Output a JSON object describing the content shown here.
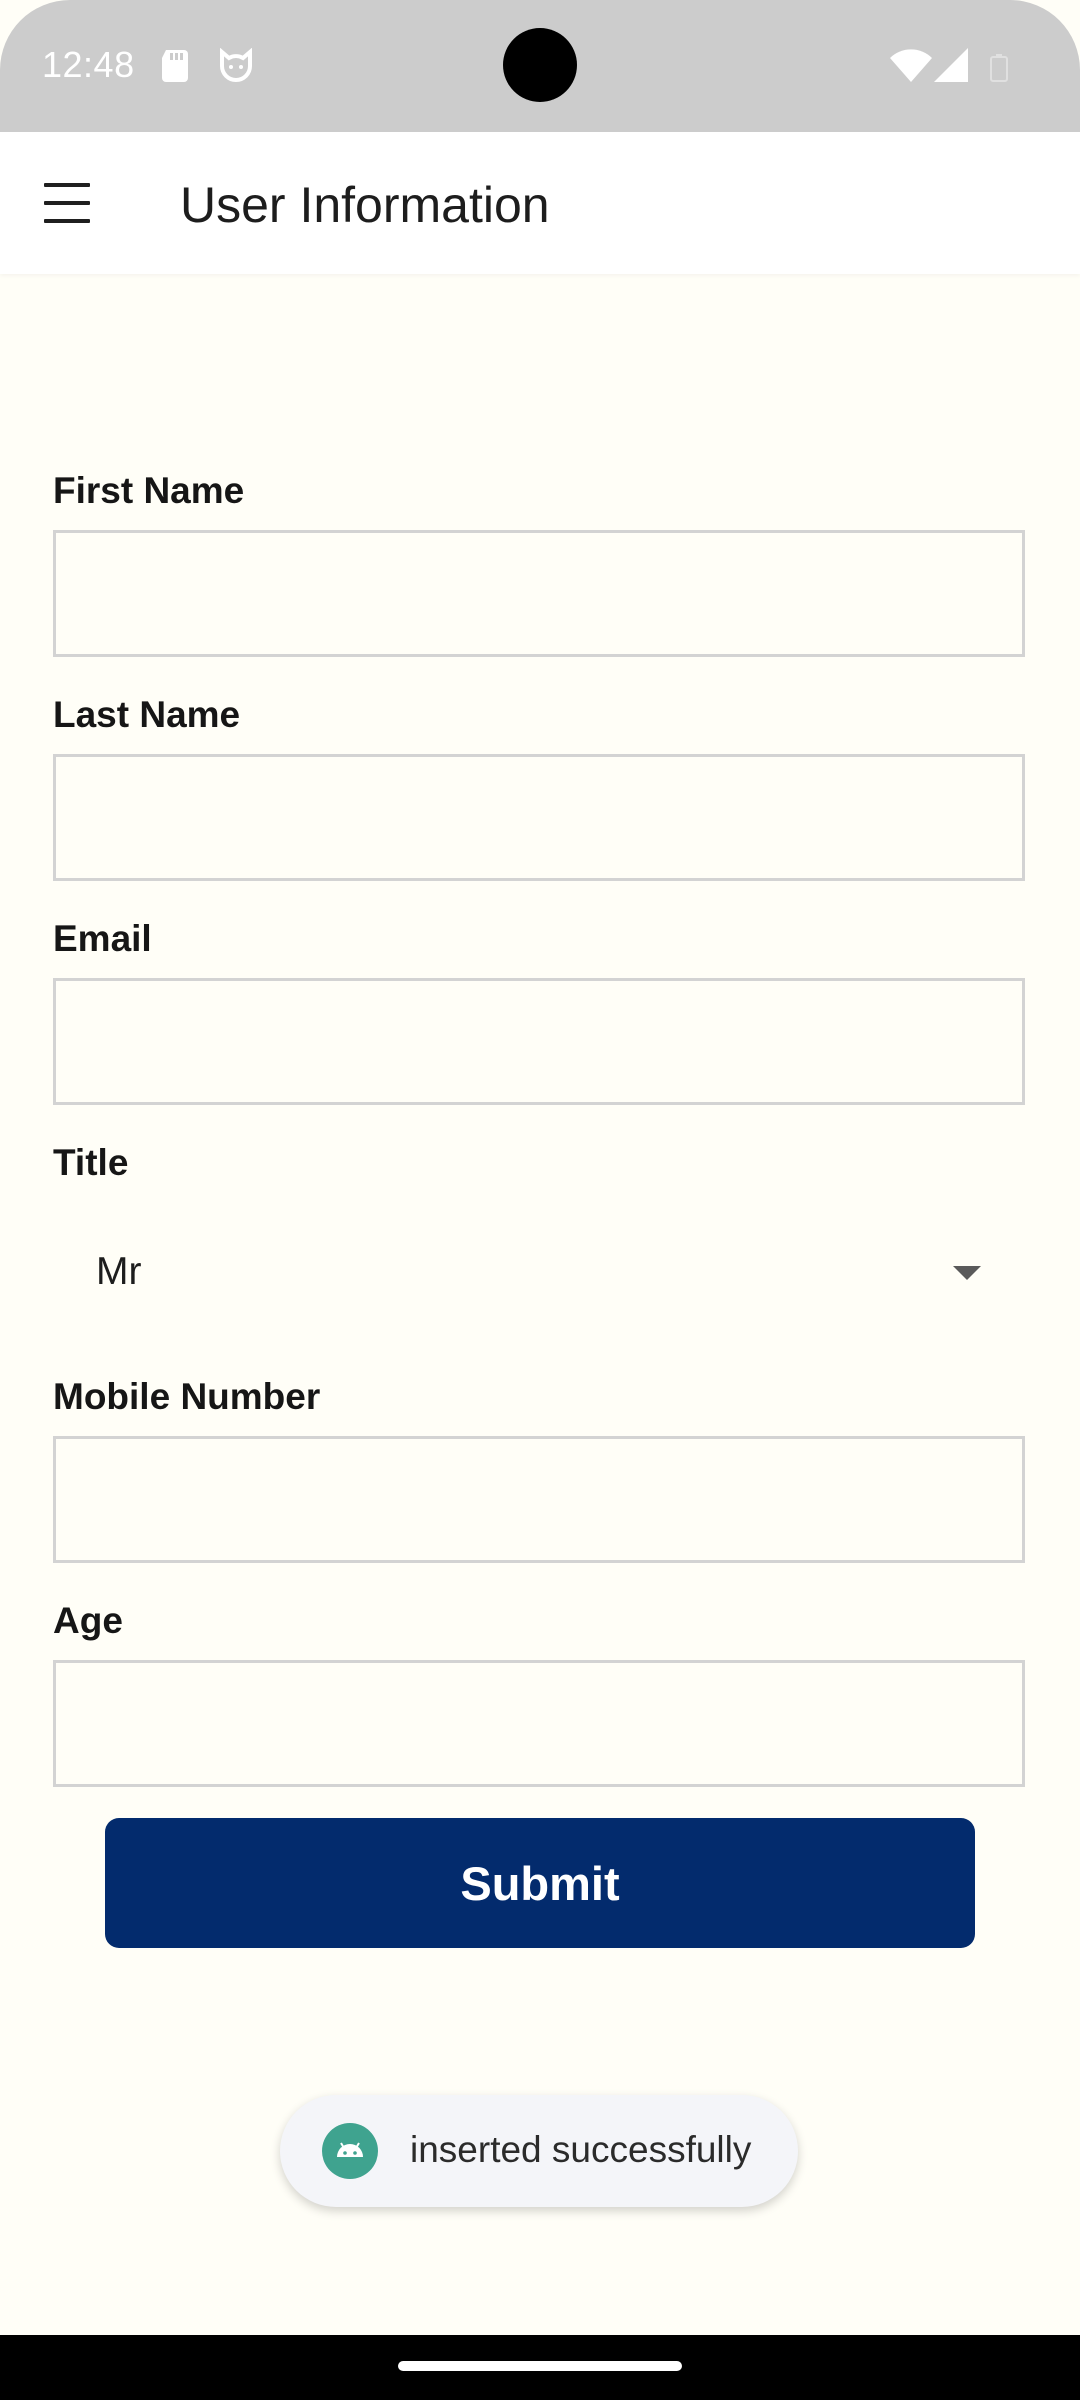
{
  "status_bar": {
    "time": "12:48",
    "icons": [
      "sd-card-icon",
      "cat-face-icon",
      "wifi-icon",
      "signal-icon",
      "battery-icon"
    ]
  },
  "app_bar": {
    "title": "User Information",
    "menu_icon": "hamburger-menu-icon"
  },
  "form": {
    "first_name": {
      "label": "First Name",
      "value": ""
    },
    "last_name": {
      "label": "Last Name",
      "value": ""
    },
    "email": {
      "label": "Email",
      "value": ""
    },
    "title": {
      "label": "Title",
      "selected": "Mr"
    },
    "mobile_number": {
      "label": "Mobile Number",
      "value": ""
    },
    "age": {
      "label": "Age",
      "value": ""
    },
    "submit_label": "Submit"
  },
  "toast": {
    "text": "inserted successfully",
    "icon": "android-icon"
  },
  "colors": {
    "status_bar": "#cccccc",
    "app_bar": "#ffffff",
    "background": "#fffef7",
    "submit_button": "#032b6d",
    "toast_icon": "#3fa38f",
    "input_border": "#d3d3d3"
  }
}
